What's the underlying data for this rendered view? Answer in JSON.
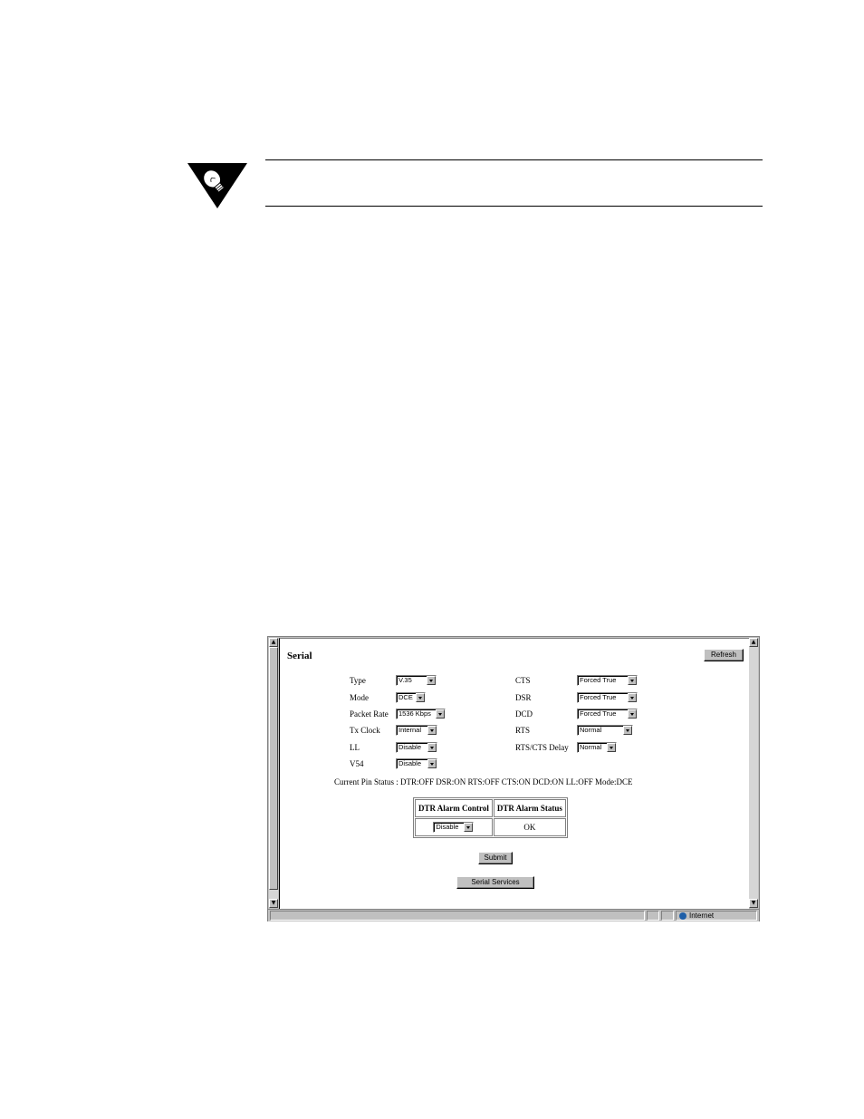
{
  "note": {
    "icon": "lightbulb-icon"
  },
  "page": {
    "title": "Serial",
    "refresh_label": "Refresh"
  },
  "left_fields": [
    {
      "label": "Type",
      "value": "V.35"
    },
    {
      "label": "Mode",
      "value": "DCE"
    },
    {
      "label": "Packet Rate",
      "value": "1536 Kbps"
    },
    {
      "label": "Tx Clock",
      "value": "Internal"
    },
    {
      "label": "LL",
      "value": "Disable"
    },
    {
      "label": "V54",
      "value": "Disable"
    }
  ],
  "right_fields": [
    {
      "label": "CTS",
      "value": "Forced True"
    },
    {
      "label": "DSR",
      "value": "Forced True"
    },
    {
      "label": "DCD",
      "value": "Forced True"
    },
    {
      "label": "RTS",
      "value": "Normal"
    },
    {
      "label": "RTS/CTS Delay",
      "value": "Normal"
    }
  ],
  "pin_status": "Current Pin Status : DTR:OFF DSR:ON RTS:OFF CTS:ON DCD:ON LL:OFF Mode:DCE",
  "dtr_table": {
    "headers": [
      "DTR Alarm Control",
      "DTR Alarm Status"
    ],
    "control_value": "Disable",
    "status_value": "OK"
  },
  "buttons": {
    "submit": "Submit",
    "serial_services": "Serial Services"
  },
  "statusbar": {
    "zone": "Internet",
    "zone_icon": "globe-icon"
  }
}
